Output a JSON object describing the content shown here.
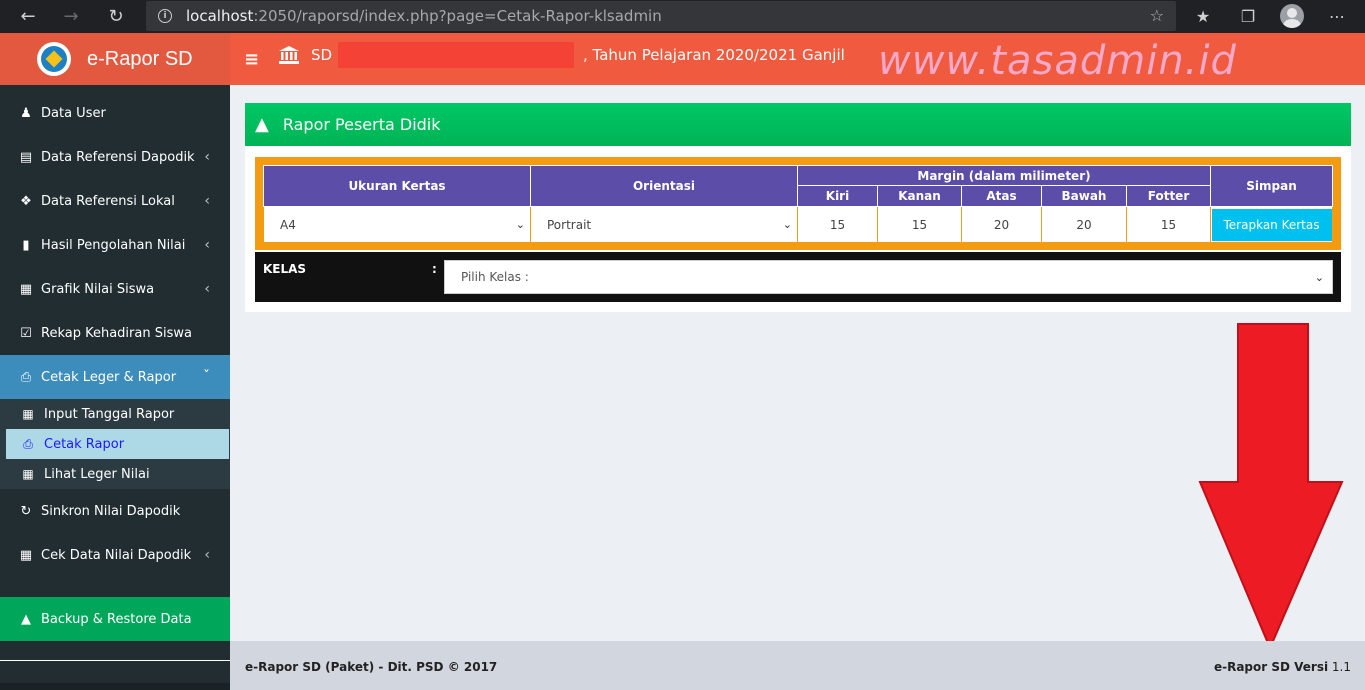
{
  "browser": {
    "url_host": "localhost",
    "url_rest": ":2050/raporsd/index.php?page=Cetak-Rapor-klsadmin"
  },
  "app": {
    "title": "e-Rapor SD",
    "school_name": "SD N",
    "tahun": ", Tahun Pelajaran 2020/2021 Ganjil",
    "watermark": "www.tasadmin.id"
  },
  "sidebar": {
    "items": [
      {
        "label": "Data User",
        "icon": "users-icon"
      },
      {
        "label": "Data Referensi Dapodik",
        "icon": "server-icon"
      },
      {
        "label": "Data Referensi Lokal",
        "icon": "tags-icon"
      },
      {
        "label": "Hasil Pengolahan Nilai",
        "icon": "book-icon"
      },
      {
        "label": "Grafik Nilai Siswa",
        "icon": "bar-chart-icon"
      },
      {
        "label": "Rekap Kehadiran Siswa",
        "icon": "check-square-icon"
      },
      {
        "label": "Cetak Leger & Rapor",
        "icon": "print-icon"
      },
      {
        "label": "Sinkron Nilai Dapodik",
        "icon": "refresh-icon"
      },
      {
        "label": "Cek Data Nilai Dapodik",
        "icon": "th-large-icon"
      },
      {
        "label": "Backup & Restore Data",
        "icon": "upload-icon"
      }
    ],
    "sub_items": [
      {
        "label": "Input Tanggal Rapor",
        "icon": "calendar-icon"
      },
      {
        "label": "Cetak Rapor",
        "icon": "print-icon"
      },
      {
        "label": "Lihat Leger Nilai",
        "icon": "grid-icon"
      }
    ]
  },
  "panel": {
    "title": "Rapor Peserta Didik",
    "headers": {
      "ukuran": "Ukuran Kertas",
      "orientasi": "Orientasi",
      "margin": "Margin (dalam milimeter)",
      "simpan": "Simpan",
      "kiri": "Kiri",
      "kanan": "Kanan",
      "atas": "Atas",
      "bawah": "Bawah",
      "fotter": "Fotter"
    },
    "values": {
      "ukuran": "A4",
      "orientasi": "Portrait",
      "kiri": "15",
      "kanan": "15",
      "atas": "20",
      "bawah": "20",
      "fotter": "15"
    },
    "apply_button": "Terapkan Kertas",
    "kelas_label": "KELAS",
    "kelas_colon": ":",
    "kelas_placeholder": "Pilih Kelas :"
  },
  "footer": {
    "left": "e-Rapor SD (Paket) - Dit. PSD © 2017",
    "right_bold": "e-Rapor SD Versi",
    "right_version": " 1.1"
  },
  "colors": {
    "header": "#f05a3e",
    "sidebar": "#222d32",
    "active": "#3c8dbc",
    "panel_header": "#00b455",
    "table_header": "#5c4da8",
    "table_border": "#f39c12",
    "apply_button": "#00c0ef",
    "arrow": "#ed1c24"
  }
}
